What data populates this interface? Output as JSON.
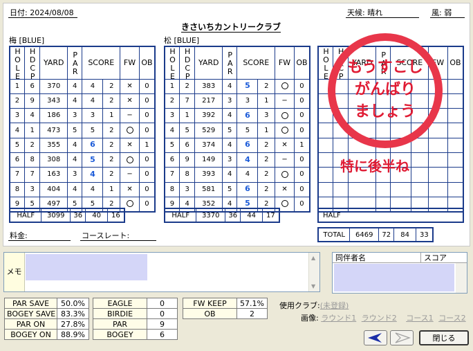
{
  "header": {
    "date": "日付: 2024/08/08",
    "weather": "天候: 晴れ",
    "wind": "風: 弱",
    "course": "きさいちカントリークラブ"
  },
  "front": {
    "label": "梅 [BLUE]",
    "cols": {
      "hole": "HOLE",
      "hdcp": "HDCP",
      "yard": "YARD",
      "par": "PAR",
      "score": "SCORE",
      "fw": "FW",
      "ob": "OB"
    },
    "rows": [
      {
        "hole": "1",
        "hdcp": "6",
        "yard": "370",
        "par": "4",
        "score": "4",
        "putt": "2",
        "fw": "x",
        "ob": "0"
      },
      {
        "hole": "2",
        "hdcp": "9",
        "yard": "343",
        "par": "4",
        "score": "4",
        "putt": "2",
        "fw": "x",
        "ob": "0"
      },
      {
        "hole": "3",
        "hdcp": "4",
        "yard": "186",
        "par": "3",
        "score": "3",
        "putt": "1",
        "fw": "-",
        "ob": "0"
      },
      {
        "hole": "4",
        "hdcp": "1",
        "yard": "473",
        "par": "5",
        "score": "5",
        "putt": "2",
        "fw": "o",
        "ob": "0"
      },
      {
        "hole": "5",
        "hdcp": "2",
        "yard": "355",
        "par": "4",
        "score": "6",
        "putt": "2",
        "fw": "x",
        "ob": "1"
      },
      {
        "hole": "6",
        "hdcp": "8",
        "yard": "308",
        "par": "4",
        "score": "5",
        "putt": "2",
        "fw": "o",
        "ob": "0"
      },
      {
        "hole": "7",
        "hdcp": "7",
        "yard": "163",
        "par": "3",
        "score": "4",
        "putt": "2",
        "fw": "-",
        "ob": "0"
      },
      {
        "hole": "8",
        "hdcp": "3",
        "yard": "404",
        "par": "4",
        "score": "4",
        "putt": "1",
        "fw": "x",
        "ob": "0"
      },
      {
        "hole": "9",
        "hdcp": "5",
        "yard": "497",
        "par": "5",
        "score": "5",
        "putt": "2",
        "fw": "o",
        "ob": "0"
      }
    ],
    "half": {
      "label": "HALF",
      "yard": "3099",
      "par": "36",
      "score": "40",
      "putt": "16"
    }
  },
  "back": {
    "label": "松 [BLUE]",
    "rows": [
      {
        "hole": "1",
        "hdcp": "2",
        "yard": "383",
        "par": "4",
        "score": "5",
        "putt": "2",
        "fw": "o",
        "ob": "0"
      },
      {
        "hole": "2",
        "hdcp": "7",
        "yard": "217",
        "par": "3",
        "score": "3",
        "putt": "1",
        "fw": "-",
        "ob": "0"
      },
      {
        "hole": "3",
        "hdcp": "1",
        "yard": "392",
        "par": "4",
        "score": "6",
        "putt": "3",
        "fw": "o",
        "ob": "0"
      },
      {
        "hole": "4",
        "hdcp": "5",
        "yard": "529",
        "par": "5",
        "score": "5",
        "putt": "1",
        "fw": "o",
        "ob": "0"
      },
      {
        "hole": "5",
        "hdcp": "6",
        "yard": "374",
        "par": "4",
        "score": "6",
        "putt": "2",
        "fw": "x",
        "ob": "1"
      },
      {
        "hole": "6",
        "hdcp": "9",
        "yard": "149",
        "par": "3",
        "score": "4",
        "putt": "2",
        "fw": "-",
        "ob": "0"
      },
      {
        "hole": "7",
        "hdcp": "8",
        "yard": "393",
        "par": "4",
        "score": "4",
        "putt": "2",
        "fw": "o",
        "ob": "0"
      },
      {
        "hole": "8",
        "hdcp": "3",
        "yard": "581",
        "par": "5",
        "score": "6",
        "putt": "2",
        "fw": "x",
        "ob": "0"
      },
      {
        "hole": "9",
        "hdcp": "4",
        "yard": "352",
        "par": "4",
        "score": "5",
        "putt": "2",
        "fw": "o",
        "ob": "0"
      }
    ],
    "half": {
      "label": "HALF",
      "yard": "3370",
      "par": "36",
      "score": "44",
      "putt": "17"
    }
  },
  "third": {
    "cols": {
      "hole": "HOLE",
      "hdcp": "HDCP",
      "yard": "YARD",
      "par": "PAR",
      "score": "SCORE",
      "fw": "FW",
      "ob": "OB"
    },
    "half_label": "HALF",
    "total": {
      "label": "TOTAL",
      "yard": "6469",
      "par": "72",
      "score": "84",
      "putt": "33"
    }
  },
  "stamp": {
    "lines": [
      "もうすこし",
      "がんばり",
      "ましょう"
    ],
    "note": "特に後半ね",
    "color": "#e01c34"
  },
  "fees": {
    "fee": "料金:",
    "rating": "コースレート:"
  },
  "memo": {
    "label": "メモ"
  },
  "companions": {
    "name_col": "同伴者名",
    "score_col": "スコア"
  },
  "stats1": [
    {
      "label": "PAR SAVE",
      "value": "50.0%"
    },
    {
      "label": "BOGEY SAVE",
      "value": "83.3%"
    },
    {
      "label": "PAR ON",
      "value": "27.8%"
    },
    {
      "label": "BOGEY ON",
      "value": "88.9%"
    }
  ],
  "stats2": [
    {
      "label": "EAGLE",
      "value": "0"
    },
    {
      "label": "BIRDIE",
      "value": "0"
    },
    {
      "label": "PAR",
      "value": "9"
    },
    {
      "label": "BOGEY",
      "value": "6"
    }
  ],
  "stats3": [
    {
      "label": "FW KEEP",
      "value": "57.1%"
    },
    {
      "label": "OB",
      "value": "2"
    }
  ],
  "club": {
    "label": "使用クラブ:",
    "value": "(未登録)"
  },
  "image": {
    "label": "画像:",
    "links": [
      "ラウンド1",
      "ラウンド2",
      "コース1",
      "コース2"
    ]
  },
  "buttons": {
    "close": "閉じる",
    "prev_icon": "left-arrow-icon",
    "next_icon": "right-arrow-icon"
  },
  "colors": {
    "grid": "#1a3a8a",
    "score_highlight": "#1a5ad8",
    "memo_bg": "#d4d6f8"
  }
}
